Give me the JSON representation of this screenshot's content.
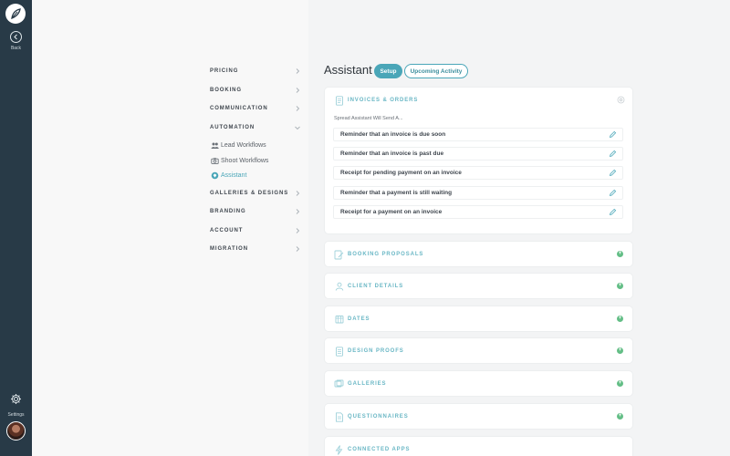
{
  "rail": {
    "back_label": "Back",
    "settings_label": "Settings"
  },
  "subnav": {
    "items": [
      {
        "label": "PRICING",
        "expanded": false
      },
      {
        "label": "BOOKING",
        "expanded": false
      },
      {
        "label": "COMMUNICATION",
        "expanded": false
      },
      {
        "label": "AUTOMATION",
        "expanded": true
      },
      {
        "label": "GALLERIES & DESIGNS",
        "expanded": false
      },
      {
        "label": "BRANDING",
        "expanded": false
      },
      {
        "label": "ACCOUNT",
        "expanded": false
      },
      {
        "label": "MIGRATION",
        "expanded": false
      }
    ],
    "automation_children": [
      {
        "label": "Lead Workflows",
        "icon": "people-icon",
        "active": false
      },
      {
        "label": "Shoot Workflows",
        "icon": "camera-icon",
        "active": false
      },
      {
        "label": "Assistant",
        "icon": "gem-icon",
        "active": true
      }
    ]
  },
  "main": {
    "title": "Assistant",
    "tabs": [
      {
        "label": "Setup",
        "active": true
      },
      {
        "label": "Upcoming Activity",
        "active": false
      }
    ],
    "invoices_card": {
      "title": "INVOICES & ORDERS",
      "intro": "Spread Assistant Will Send A...",
      "rows": [
        "Reminder that an invoice is due soon",
        "Reminder that an invoice is past due",
        "Receipt for pending payment on an invoice",
        "Reminder that a payment is still waiting",
        "Receipt for a payment on an invoice"
      ]
    },
    "sections": [
      {
        "title": "BOOKING PROPOSALS",
        "icon": "proposal-icon"
      },
      {
        "title": "CLIENT DETAILS",
        "icon": "user-icon"
      },
      {
        "title": "DATES",
        "icon": "calendar-icon"
      },
      {
        "title": "DESIGN PROOFS",
        "icon": "document-icon"
      },
      {
        "title": "GALLERIES",
        "icon": "gallery-icon"
      },
      {
        "title": "QUESTIONNAIRES",
        "icon": "questionnaire-icon"
      },
      {
        "title": "CONNECTED APPS",
        "icon": "lightning-icon"
      }
    ]
  },
  "colors": {
    "rail": "#283a47",
    "accent": "#4aa6b8",
    "plus": "#63be86",
    "section_title": "#6ab7c5"
  }
}
